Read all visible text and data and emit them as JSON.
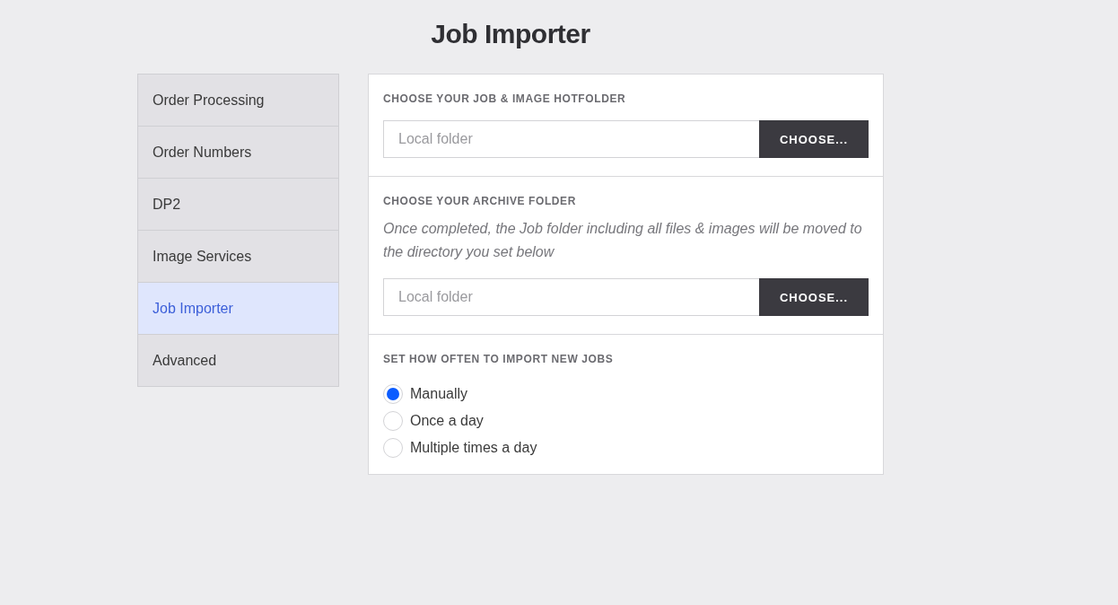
{
  "title": "Job Importer",
  "sidebar": {
    "items": [
      {
        "label": "Order Processing",
        "selected": false
      },
      {
        "label": "Order Numbers",
        "selected": false
      },
      {
        "label": "DP2",
        "selected": false
      },
      {
        "label": "Image Services",
        "selected": false
      },
      {
        "label": "Job Importer",
        "selected": true
      },
      {
        "label": "Advanced",
        "selected": false
      }
    ]
  },
  "sections": [
    {
      "kind": "folder",
      "heading": "CHOOSE YOUR JOB & IMAGE HOTFOLDER",
      "placeholder": "Local folder",
      "button": "CHOOSE..."
    },
    {
      "kind": "folder",
      "heading": "CHOOSE YOUR ARCHIVE FOLDER",
      "description": "Once completed, the Job folder including all files & images will be moved to the directory you set below",
      "placeholder": "Local folder",
      "button": "CHOOSE..."
    },
    {
      "kind": "radio",
      "heading": "SET HOW OFTEN TO IMPORT NEW JOBS",
      "options": [
        {
          "label": "Manually",
          "selected": true
        },
        {
          "label": "Once a day",
          "selected": false
        },
        {
          "label": "Multiple times a day",
          "selected": false
        }
      ]
    }
  ]
}
